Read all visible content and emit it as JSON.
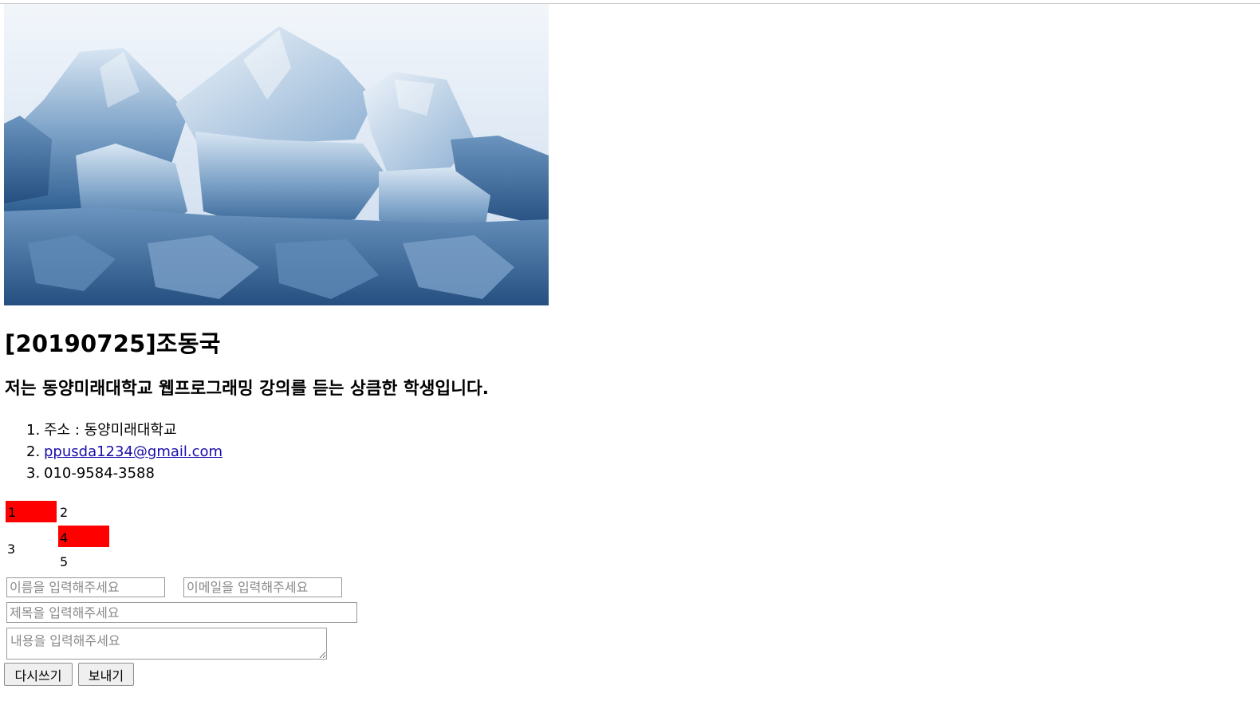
{
  "title": "[20190725]조동국",
  "subtitle": "저는 동양미래대학교 웹프로그래밍 강의를 듣는 상큼한 학생입니다.",
  "info_list": [
    {
      "num": "1.",
      "text": "주소 : 동양미래대학교"
    },
    {
      "num": "2.",
      "text": "ppusda1234@gmail.com"
    },
    {
      "num": "3.",
      "text": "010-9584-3588"
    }
  ],
  "table_cells": [
    "1",
    "2",
    "3",
    "4",
    "5"
  ],
  "form": {
    "name_placeholder": "이름을 입력해주세요",
    "email_placeholder": "이메일을 입력해주세요",
    "subject_placeholder": "제목을 입력해주세요",
    "content_placeholder": "내용을 입력해주세요",
    "reset_label": "다시쓰기",
    "submit_label": "보내기"
  },
  "colors": {
    "highlight": "#ff0000",
    "link": "#1a0dab"
  }
}
